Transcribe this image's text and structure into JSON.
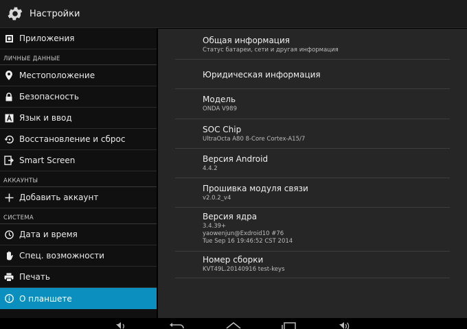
{
  "actionbar": {
    "title": "Настройки",
    "icon": "settings-gear-icon"
  },
  "sidebar": {
    "items": [
      {
        "type": "item",
        "label": "Приложения",
        "icon": "apps-icon"
      },
      {
        "type": "header",
        "label": "ЛИЧНЫЕ ДАННЫЕ"
      },
      {
        "type": "item",
        "label": "Местоположение",
        "icon": "location-pin-icon"
      },
      {
        "type": "item",
        "label": "Безопасность",
        "icon": "lock-icon"
      },
      {
        "type": "item",
        "label": "Язык и ввод",
        "icon": "keyboard-a-icon"
      },
      {
        "type": "item",
        "label": "Восстановление и сброс",
        "icon": "restore-icon"
      },
      {
        "type": "item",
        "label": "Smart Screen",
        "icon": "cast-screen-icon"
      },
      {
        "type": "header",
        "label": "АККАУНТЫ"
      },
      {
        "type": "item",
        "label": "Добавить аккаунт",
        "icon": "plus-icon"
      },
      {
        "type": "header",
        "label": "СИСТЕМА"
      },
      {
        "type": "item",
        "label": "Дата и время",
        "icon": "clock-icon"
      },
      {
        "type": "item",
        "label": "Спец. возможности",
        "icon": "hand-icon"
      },
      {
        "type": "item",
        "label": "Печать",
        "icon": "printer-icon"
      },
      {
        "type": "item",
        "label": "О планшете",
        "icon": "info-icon",
        "active": true
      }
    ]
  },
  "content": {
    "rows": [
      {
        "title": "Общая информация",
        "subtitle": "Статус батареи, сети и другая информация"
      },
      {
        "title": "Юридическая информация",
        "subtitle": ""
      },
      {
        "title": "Модель",
        "subtitle": "ONDA V989"
      },
      {
        "title": "SOC Chip",
        "subtitle": "UltraOcta A80 8-Core Cortex-A15/7"
      },
      {
        "title": "Версия Android",
        "subtitle": "4.4.2"
      },
      {
        "title": "Прошивка модуля связи",
        "subtitle": "v2.0.2_v4"
      },
      {
        "title": "Версия ядра",
        "subtitle": "3.4.39+\nyaowenjun@Exdroid10 #76\nTue Sep 16 19:46:52 CST 2014"
      },
      {
        "title": "Номер сборки",
        "subtitle": "KVT49L.20140916 test-keys"
      }
    ]
  },
  "navbar": {
    "icons": [
      "volume-down-icon",
      "back-icon",
      "home-icon",
      "recents-icon",
      "volume-up-icon"
    ]
  },
  "colors": {
    "accent": "#0a8fbf",
    "content_bg": "#262626",
    "sidebar_bg": "#101010"
  }
}
